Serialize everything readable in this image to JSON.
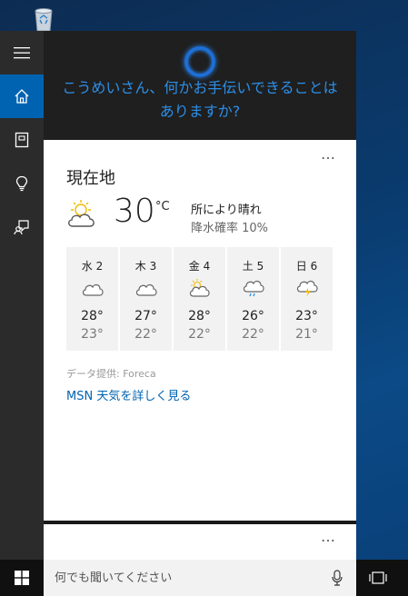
{
  "colors": {
    "accent": "#0063b1",
    "greeting": "#2c8fe8",
    "rail_bg": "#2b2b2b",
    "header_bg": "#1f1f1f"
  },
  "rail": {
    "items": [
      {
        "icon": "hamburger-menu-icon"
      },
      {
        "icon": "home-icon",
        "active": true
      },
      {
        "icon": "notebook-icon"
      },
      {
        "icon": "lightbulb-icon"
      },
      {
        "icon": "feedback-icon"
      }
    ]
  },
  "header": {
    "greeting": "こうめいさん、何かお手伝いできることはありますか?"
  },
  "weather": {
    "more": "…",
    "location": "現在地",
    "temperature": "30",
    "unit": "°C",
    "condition": "所により晴れ",
    "precipitation": "降水確率 10%",
    "forecast": [
      {
        "day": "水 2",
        "icon": "cloud-icon",
        "high": "28°",
        "low": "23°"
      },
      {
        "day": "木 3",
        "icon": "cloud-icon",
        "high": "27°",
        "low": "22°"
      },
      {
        "day": "金 4",
        "icon": "sun-cloud-icon",
        "high": "28°",
        "low": "22°"
      },
      {
        "day": "土 5",
        "icon": "rain-cloud-icon",
        "high": "26°",
        "low": "22°"
      },
      {
        "day": "日 6",
        "icon": "thunder-cloud-icon",
        "high": "23°",
        "low": "21°"
      }
    ],
    "source": "データ提供: Foreca",
    "link": "MSN 天気を詳しく見る"
  },
  "card2": {
    "more": "…"
  },
  "taskbar": {
    "search_placeholder": "何でも聞いてください"
  }
}
